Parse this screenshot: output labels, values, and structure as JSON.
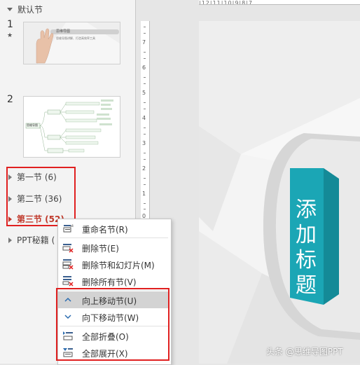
{
  "sections_panel": {
    "default_section": "默认节",
    "slides": [
      {
        "number": "1",
        "star": "★",
        "thumb_title": "思维导图",
        "thumb_subtitle": "思维导图讲解、打造高效率工具"
      },
      {
        "number": "2",
        "thumb_root": "思维导图"
      }
    ],
    "sections": [
      {
        "label": "第一节 (6)",
        "collapsed": true
      },
      {
        "label": "第二节 (36)",
        "collapsed": true
      },
      {
        "label": "第三节 (52)",
        "collapsed": true,
        "selected": true
      },
      {
        "label": "PPT秘籍 (",
        "collapsed": true
      }
    ]
  },
  "context_menu": {
    "items": [
      {
        "label": "重命名节(R)",
        "icon": "rename-section-icon"
      },
      {
        "label": "删除节(E)",
        "icon": "delete-section-icon"
      },
      {
        "label": "删除节和幻灯片(M)",
        "icon": "delete-section-slides-icon"
      },
      {
        "label": "删除所有节(V)",
        "icon": "delete-all-sections-icon"
      },
      {
        "label": "向上移动节(U)",
        "icon": "chevron-up-icon",
        "highlighted": true
      },
      {
        "label": "向下移动节(W)",
        "icon": "chevron-down-icon"
      },
      {
        "label": "全部折叠(O)",
        "icon": "collapse-all-icon"
      },
      {
        "label": "全部展开(X)",
        "icon": "expand-all-icon"
      }
    ]
  },
  "ruler": {
    "top_text": "|12|11|10|9|8|7",
    "left_numbers": [
      "7",
      "6",
      "5",
      "4",
      "3",
      "2",
      "1",
      "0"
    ]
  },
  "slide_canvas": {
    "title": "添加标题",
    "accent_color": "#1ba6b5"
  },
  "watermark": "头条 @思维导图PPT",
  "colors": {
    "highlight_red": "#e02020",
    "selected_section": "#c0392b"
  }
}
